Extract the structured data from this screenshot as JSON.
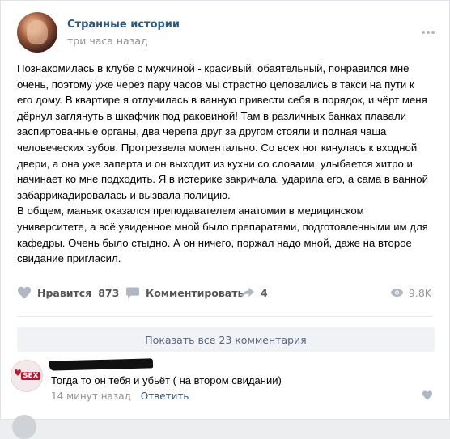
{
  "post": {
    "group_name": "Странные истории",
    "time": "три часа назад",
    "text_lines": [
      "Познакомилась в клубе с мужчиной - красивый, обаятельный, понравился мне",
      "очень, поэтому уже через пару часов мы страстно целовались в такси на пути к",
      "его дому. В квартире я отлучилась в ванную привести себя в порядок, и чёрт меня",
      "дёрнул заглянуть в шкафчик под раковиной! Там в различных банках плавали",
      "заспиртованные органы, два черепа друг за другом стояли и полная чаша",
      "человеческих зубов. Протрезвела моментально. Со всех ног кинулась к входной",
      "двери, а она уже заперта и он выходит из кухни со словами, улыбается хитро и",
      "начинает ко мне подходить. Я в истерике закричала, ударила его, а сама в ванной",
      "забаррикадировалась и вызвала полицию.",
      "В общем, маньяк оказался преподавателем анатомии в медицинском",
      "университете, а всё увиденное мной было препаратами, подготовленными им для",
      "кафедры. Очень было стыдно. А он ничего, поржал надо мной, даже на второе",
      "свидание пригласил."
    ]
  },
  "actions": {
    "like_label": "Нравится",
    "like_count": "873",
    "comment_label": "Комментировать",
    "share_count": "4",
    "views": "9.8K"
  },
  "comments": {
    "show_all_label": "Показать все 23 комментария",
    "items": [
      {
        "avatar_text": "SEX",
        "text": "Тогда то он тебя и убьёт ( на втором свидании)",
        "time": "14 минут назад",
        "reply_label": "Ответить"
      }
    ]
  },
  "colors": {
    "link": "#2a5885",
    "muted": "#939393",
    "icon": "#aeb7c2",
    "button_bg": "#f0f2f5"
  },
  "icons": [
    "more-icon",
    "heart-icon",
    "comment-icon",
    "share-icon",
    "eye-icon"
  ]
}
